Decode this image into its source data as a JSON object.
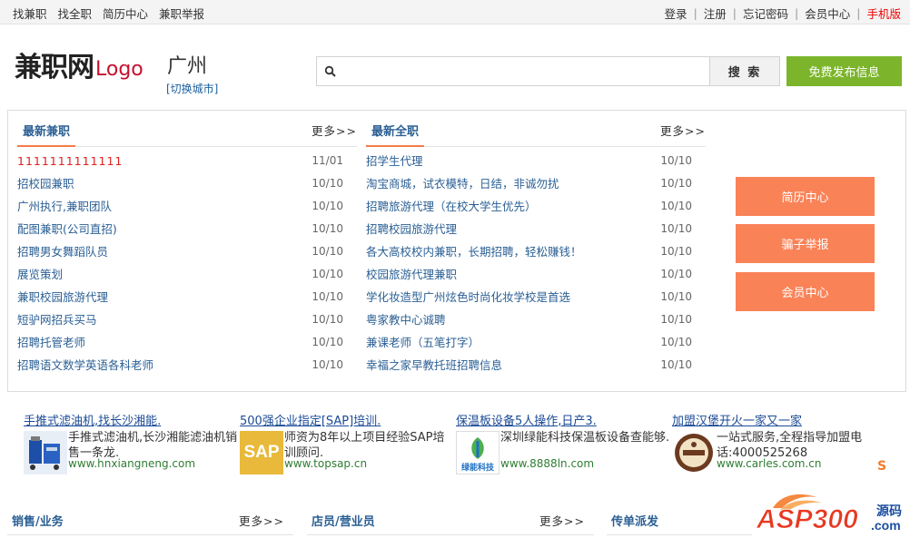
{
  "topbar": {
    "left_links": [
      "找兼职",
      "找全职",
      "简历中心",
      "兼职举报"
    ],
    "right_links": [
      "登录",
      "注册",
      "忘记密码",
      "会员中心"
    ],
    "mobile": "手机版"
  },
  "header": {
    "site_name": "兼职网",
    "logo_word": "Logo",
    "city": "广州",
    "switch_city": "[切换城市]",
    "search_placeholder": "",
    "search_label": "搜 索",
    "publish_label": "免费发布信息"
  },
  "parttime": {
    "title": "最新兼职",
    "more": "更多>>",
    "items": [
      {
        "title": "1111111111111",
        "date": "11/01"
      },
      {
        "title": "招校园兼职",
        "date": "10/10"
      },
      {
        "title": "广州执行,兼职团队",
        "date": "10/10"
      },
      {
        "title": "配图兼职(公司直招)",
        "date": "10/10"
      },
      {
        "title": "招聘男女舞蹈队员",
        "date": "10/10"
      },
      {
        "title": "展览策划",
        "date": "10/10"
      },
      {
        "title": "兼职校园旅游代理",
        "date": "10/10"
      },
      {
        "title": "短驴网招兵买马",
        "date": "10/10"
      },
      {
        "title": "招聘托管老师",
        "date": "10/10"
      },
      {
        "title": "招聘语文数学英语各科老师",
        "date": "10/10"
      }
    ]
  },
  "fulltime": {
    "title": "最新全职",
    "more": "更多>>",
    "items": [
      {
        "title": "招学生代理",
        "date": "10/10"
      },
      {
        "title": "淘宝商城，试衣模特，日结，非诚勿扰",
        "date": "10/10"
      },
      {
        "title": "招聘旅游代理（在校大学生优先）",
        "date": "10/10"
      },
      {
        "title": "招聘校园旅游代理",
        "date": "10/10"
      },
      {
        "title": "各大高校校内兼职，长期招聘，轻松赚钱！",
        "date": "10/10"
      },
      {
        "title": "校园旅游代理兼职",
        "date": "10/10"
      },
      {
        "title": "学化妆造型广州炫色时尚化妆学校是首选",
        "date": "10/10"
      },
      {
        "title": "粤家教中心诚聘",
        "date": "10/10"
      },
      {
        "title": "兼课老师（五笔打字）",
        "date": "10/10"
      },
      {
        "title": "幸福之家早教托班招聘信息",
        "date": "10/10"
      }
    ]
  },
  "side_buttons": [
    "简历中心",
    "骗子举报",
    "会员中心"
  ],
  "ads": [
    {
      "title": "手推式滤油机,找长沙湘能.",
      "desc": "手推式滤油机,长沙湘能滤油机销售一条龙.",
      "url": "www.hnxiangneng.com",
      "thumb_text": ""
    },
    {
      "title": "500强企业指定[SAP]培训.",
      "desc": "师资为8年以上项目经验SAP培训顾问.",
      "url": "www.topsap.cn",
      "thumb_text": "SAP"
    },
    {
      "title": "保温板设备5人操作,日产3.",
      "desc": "深圳绿能科技保温板设备查能够.",
      "url": "www.8888ln.com",
      "thumb_text": "绿能科技"
    },
    {
      "title": "加盟汉堡开火一家又一家",
      "desc": "一站式服务,全程指导加盟电话:4000525268",
      "url": "www.carles.com.cn",
      "thumb_text": ""
    }
  ],
  "s_mark": "S",
  "bottom_sections": [
    {
      "title": "销售/业务",
      "more": "更多>>"
    },
    {
      "title": "店员/营业员",
      "more": "更多>>"
    },
    {
      "title": "传单派发",
      "more": ""
    }
  ],
  "watermark": {
    "text": "ASP300",
    "sub": "源码",
    "domain": ".com"
  },
  "colors": {
    "accent_orange": "#fa8257",
    "publish_green": "#7cb52b",
    "link_blue": "#2a5f94",
    "red": "#e02020"
  }
}
